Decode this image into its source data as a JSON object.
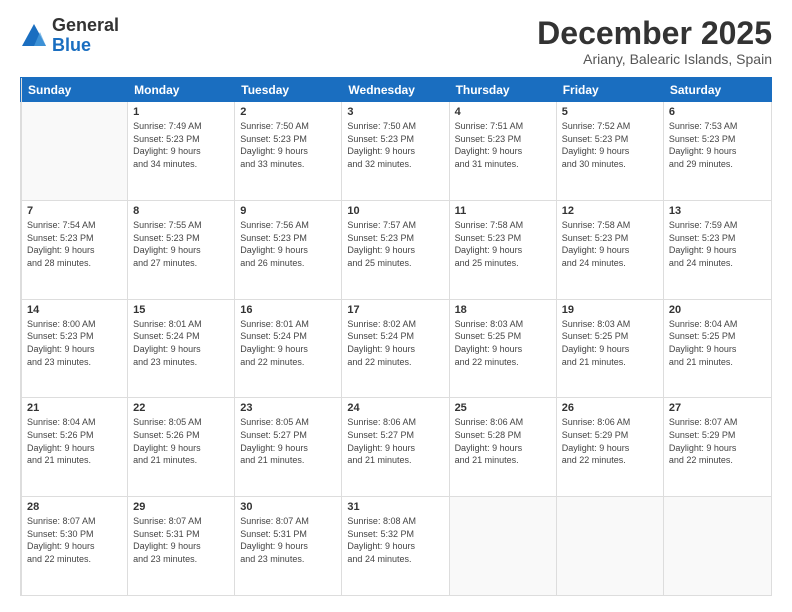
{
  "logo": {
    "general": "General",
    "blue": "Blue"
  },
  "title": "December 2025",
  "subtitle": "Ariany, Balearic Islands, Spain",
  "header_days": [
    "Sunday",
    "Monday",
    "Tuesday",
    "Wednesday",
    "Thursday",
    "Friday",
    "Saturday"
  ],
  "weeks": [
    [
      {
        "day": "",
        "info": ""
      },
      {
        "day": "1",
        "info": "Sunrise: 7:49 AM\nSunset: 5:23 PM\nDaylight: 9 hours\nand 34 minutes."
      },
      {
        "day": "2",
        "info": "Sunrise: 7:50 AM\nSunset: 5:23 PM\nDaylight: 9 hours\nand 33 minutes."
      },
      {
        "day": "3",
        "info": "Sunrise: 7:50 AM\nSunset: 5:23 PM\nDaylight: 9 hours\nand 32 minutes."
      },
      {
        "day": "4",
        "info": "Sunrise: 7:51 AM\nSunset: 5:23 PM\nDaylight: 9 hours\nand 31 minutes."
      },
      {
        "day": "5",
        "info": "Sunrise: 7:52 AM\nSunset: 5:23 PM\nDaylight: 9 hours\nand 30 minutes."
      },
      {
        "day": "6",
        "info": "Sunrise: 7:53 AM\nSunset: 5:23 PM\nDaylight: 9 hours\nand 29 minutes."
      }
    ],
    [
      {
        "day": "7",
        "info": "Sunrise: 7:54 AM\nSunset: 5:23 PM\nDaylight: 9 hours\nand 28 minutes."
      },
      {
        "day": "8",
        "info": "Sunrise: 7:55 AM\nSunset: 5:23 PM\nDaylight: 9 hours\nand 27 minutes."
      },
      {
        "day": "9",
        "info": "Sunrise: 7:56 AM\nSunset: 5:23 PM\nDaylight: 9 hours\nand 26 minutes."
      },
      {
        "day": "10",
        "info": "Sunrise: 7:57 AM\nSunset: 5:23 PM\nDaylight: 9 hours\nand 25 minutes."
      },
      {
        "day": "11",
        "info": "Sunrise: 7:58 AM\nSunset: 5:23 PM\nDaylight: 9 hours\nand 25 minutes."
      },
      {
        "day": "12",
        "info": "Sunrise: 7:58 AM\nSunset: 5:23 PM\nDaylight: 9 hours\nand 24 minutes."
      },
      {
        "day": "13",
        "info": "Sunrise: 7:59 AM\nSunset: 5:23 PM\nDaylight: 9 hours\nand 24 minutes."
      }
    ],
    [
      {
        "day": "14",
        "info": "Sunrise: 8:00 AM\nSunset: 5:23 PM\nDaylight: 9 hours\nand 23 minutes."
      },
      {
        "day": "15",
        "info": "Sunrise: 8:01 AM\nSunset: 5:24 PM\nDaylight: 9 hours\nand 23 minutes."
      },
      {
        "day": "16",
        "info": "Sunrise: 8:01 AM\nSunset: 5:24 PM\nDaylight: 9 hours\nand 22 minutes."
      },
      {
        "day": "17",
        "info": "Sunrise: 8:02 AM\nSunset: 5:24 PM\nDaylight: 9 hours\nand 22 minutes."
      },
      {
        "day": "18",
        "info": "Sunrise: 8:03 AM\nSunset: 5:25 PM\nDaylight: 9 hours\nand 22 minutes."
      },
      {
        "day": "19",
        "info": "Sunrise: 8:03 AM\nSunset: 5:25 PM\nDaylight: 9 hours\nand 21 minutes."
      },
      {
        "day": "20",
        "info": "Sunrise: 8:04 AM\nSunset: 5:25 PM\nDaylight: 9 hours\nand 21 minutes."
      }
    ],
    [
      {
        "day": "21",
        "info": "Sunrise: 8:04 AM\nSunset: 5:26 PM\nDaylight: 9 hours\nand 21 minutes."
      },
      {
        "day": "22",
        "info": "Sunrise: 8:05 AM\nSunset: 5:26 PM\nDaylight: 9 hours\nand 21 minutes."
      },
      {
        "day": "23",
        "info": "Sunrise: 8:05 AM\nSunset: 5:27 PM\nDaylight: 9 hours\nand 21 minutes."
      },
      {
        "day": "24",
        "info": "Sunrise: 8:06 AM\nSunset: 5:27 PM\nDaylight: 9 hours\nand 21 minutes."
      },
      {
        "day": "25",
        "info": "Sunrise: 8:06 AM\nSunset: 5:28 PM\nDaylight: 9 hours\nand 21 minutes."
      },
      {
        "day": "26",
        "info": "Sunrise: 8:06 AM\nSunset: 5:29 PM\nDaylight: 9 hours\nand 22 minutes."
      },
      {
        "day": "27",
        "info": "Sunrise: 8:07 AM\nSunset: 5:29 PM\nDaylight: 9 hours\nand 22 minutes."
      }
    ],
    [
      {
        "day": "28",
        "info": "Sunrise: 8:07 AM\nSunset: 5:30 PM\nDaylight: 9 hours\nand 22 minutes."
      },
      {
        "day": "29",
        "info": "Sunrise: 8:07 AM\nSunset: 5:31 PM\nDaylight: 9 hours\nand 23 minutes."
      },
      {
        "day": "30",
        "info": "Sunrise: 8:07 AM\nSunset: 5:31 PM\nDaylight: 9 hours\nand 23 minutes."
      },
      {
        "day": "31",
        "info": "Sunrise: 8:08 AM\nSunset: 5:32 PM\nDaylight: 9 hours\nand 24 minutes."
      },
      {
        "day": "",
        "info": ""
      },
      {
        "day": "",
        "info": ""
      },
      {
        "day": "",
        "info": ""
      }
    ]
  ]
}
